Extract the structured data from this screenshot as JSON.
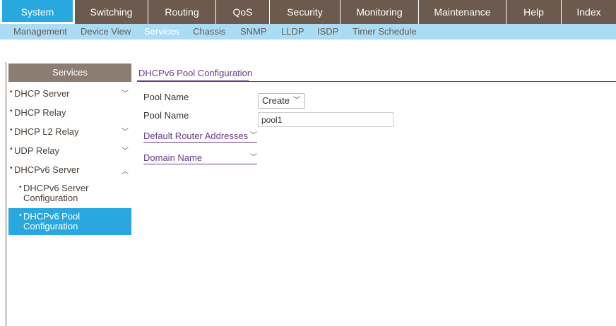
{
  "topnav": [
    {
      "label": "System",
      "active": true
    },
    {
      "label": "Switching"
    },
    {
      "label": "Routing"
    },
    {
      "label": "QoS"
    },
    {
      "label": "Security"
    },
    {
      "label": "Monitoring"
    },
    {
      "label": "Maintenance"
    },
    {
      "label": "Help"
    },
    {
      "label": "Index"
    }
  ],
  "subnav": [
    {
      "label": "Management"
    },
    {
      "label": "Device View"
    },
    {
      "label": "Services",
      "active": true
    },
    {
      "label": "Chassis"
    },
    {
      "label": "SNMP"
    },
    {
      "label": "LLDP"
    },
    {
      "label": "ISDP"
    },
    {
      "label": "Timer Schedule"
    }
  ],
  "sidebar": {
    "header": "Services",
    "items": [
      {
        "label": "DHCP Server",
        "chevron": "chevron-down"
      },
      {
        "label": "DHCP Relay"
      },
      {
        "label": "DHCP L2 Relay",
        "chevron": "chevron-down"
      },
      {
        "label": "UDP Relay",
        "chevron": "chevron-down"
      },
      {
        "label": "DHCPv6 Server",
        "chevron": "chevron-up"
      },
      {
        "label": "DHCPv6 Server Configuration"
      },
      {
        "label": "DHCPv6 Pool Configuration",
        "active": true
      }
    ]
  },
  "content": {
    "title": "DHCPv6 Pool Configuration",
    "pool_name_label_1": "Pool Name",
    "pool_name_select": "Create",
    "pool_name_label_2": "Pool Name",
    "pool_name_value": "pool1",
    "default_router_addresses": "Default Router Addresses",
    "domain_name": "Domain Name"
  },
  "colors": {
    "accent": "#29a8e0",
    "nav_bg": "#6b5a4d",
    "subnav_bg": "#aadcf5",
    "link_purple": "#6b3a8a"
  }
}
